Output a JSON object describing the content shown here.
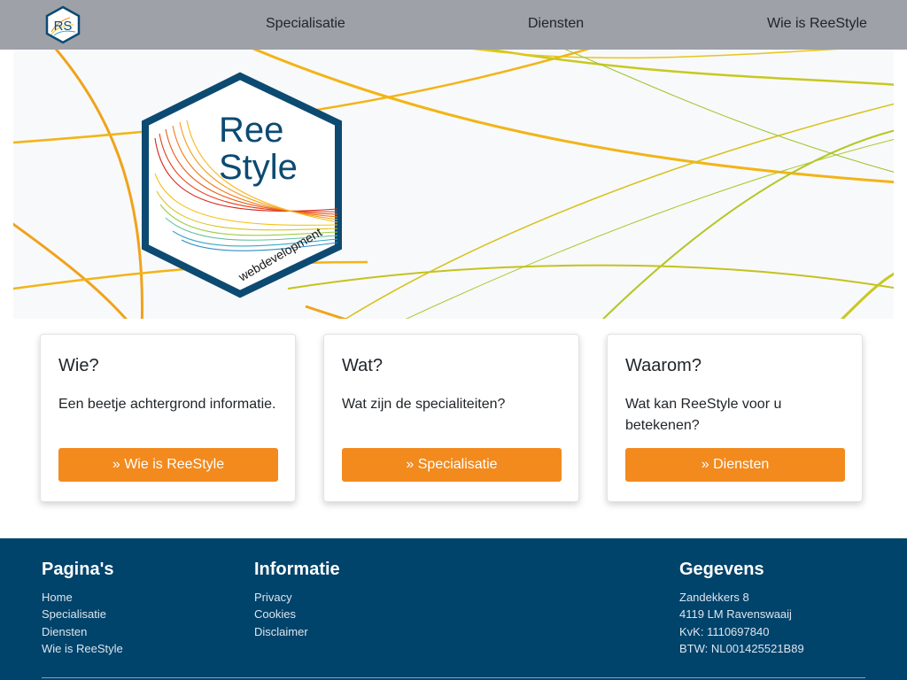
{
  "nav": {
    "logo_text": "RS",
    "links": [
      "Specialisatie",
      "Diensten",
      "Wie is ReeStyle"
    ]
  },
  "hero": {
    "logo_line1": "Ree",
    "logo_line2": "Style",
    "logo_tagline": "webdevelopment"
  },
  "cards": [
    {
      "title": "Wie?",
      "text": "Een beetje achtergrond informatie.",
      "button": "» Wie is ReeStyle"
    },
    {
      "title": "Wat?",
      "text": "Wat zijn de specialiteiten?",
      "button": "» Specialisatie"
    },
    {
      "title": "Waarom?",
      "text": "Wat kan ReeStyle voor u betekenen?",
      "button": "» Diensten"
    }
  ],
  "footer": {
    "pages": {
      "heading": "Pagina's",
      "items": [
        "Home",
        "Specialisatie",
        "Diensten",
        "Wie is ReeStyle"
      ]
    },
    "info": {
      "heading": "Informatie",
      "items": [
        "Privacy",
        "Cookies",
        "Disclaimer"
      ]
    },
    "details": {
      "heading": "Gegevens",
      "items": [
        "Zandekkers 8",
        "4119 LM Ravenswaaij",
        "KvK: 1110697840",
        "BTW: NL001425521B89"
      ]
    }
  },
  "colors": {
    "navbar": "#9ea1a8",
    "accent": "#f28a1e",
    "footer": "#00436b",
    "logo_border": "#0c4a72"
  }
}
